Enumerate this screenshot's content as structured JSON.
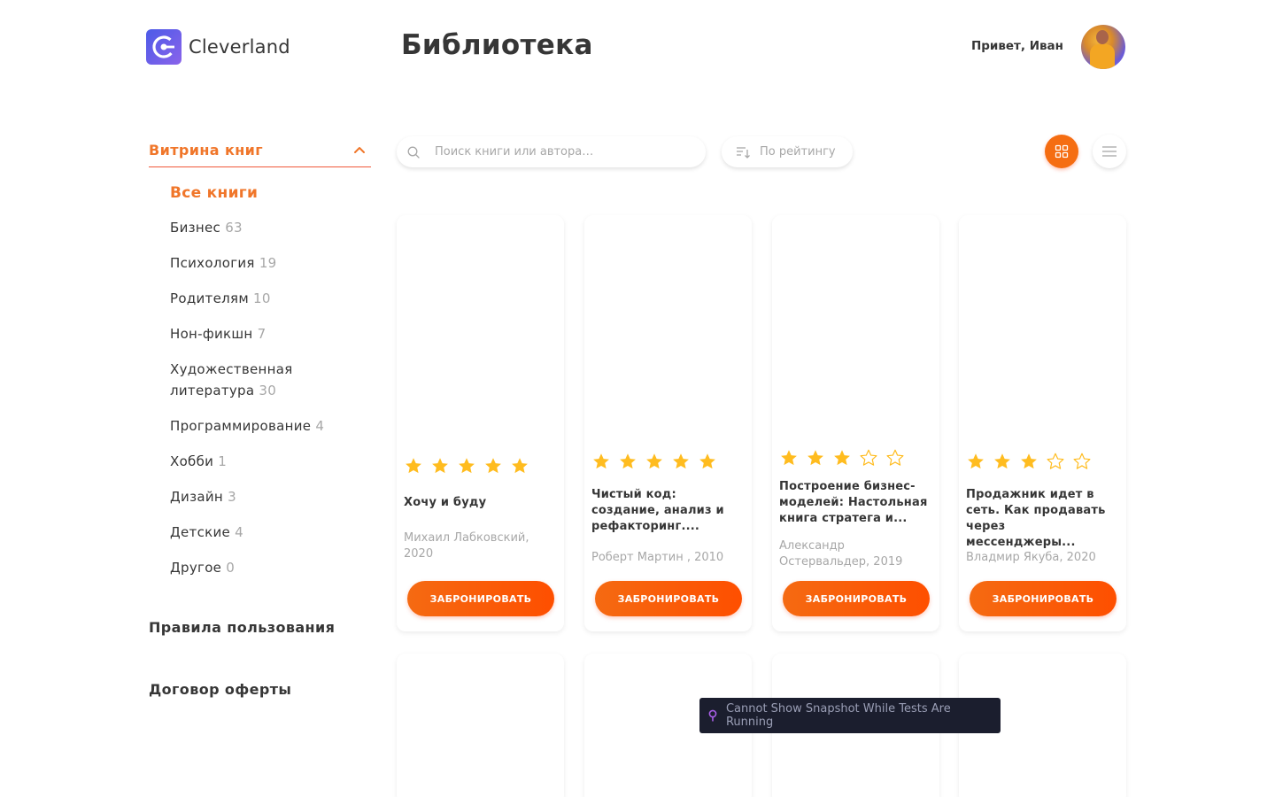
{
  "brand": {
    "name": "Cleverland",
    "accent": "#f56d12",
    "logo_color": "#6b5ee9"
  },
  "header": {
    "title": "Библиотека",
    "greeting": "Привет, Иван"
  },
  "sidebar": {
    "section_title": "Витрина книг",
    "categories": [
      {
        "label": "Все книги",
        "count": ""
      },
      {
        "label": "Бизнес",
        "count": "63"
      },
      {
        "label": "Психология",
        "count": "19"
      },
      {
        "label": "Родителям",
        "count": "10"
      },
      {
        "label": "Нон-фикшн",
        "count": "7"
      },
      {
        "label": "Художественная литература",
        "count": "30"
      },
      {
        "label": "Программирование",
        "count": "4"
      },
      {
        "label": "Хобби",
        "count": "1"
      },
      {
        "label": "Дизайн",
        "count": "3"
      },
      {
        "label": "Детские",
        "count": "4"
      },
      {
        "label": "Другое",
        "count": "0"
      }
    ],
    "rules_link": "Правила пользования",
    "offer_link": "Договор оферты"
  },
  "toolbar": {
    "search_placeholder": "Поиск книги или автора…",
    "sort_label": "По рейтингу",
    "active_view": "tiles"
  },
  "books": [
    {
      "title": "Хочу и буду",
      "author": "Михаил Лабковский, 2020",
      "rating": 5,
      "button": "ЗАБРОНИРОВАТЬ"
    },
    {
      "title": "Чистый код: создание, анализ и рефакторинг....",
      "author": "Роберт Мартин , 2010",
      "rating": 5,
      "button": "ЗАБРОНИРОВАТЬ"
    },
    {
      "title": "Построение бизнес-моделей: Настольная книга стратега и...",
      "author": "Александр Остервальдер, 2019",
      "rating": 3,
      "button": "ЗАБРОНИРОВАТЬ"
    },
    {
      "title": "Продажник идет в сеть. Как продавать через мессенджеры...",
      "author": "Владмир Якуба, 2020",
      "rating": 3,
      "button": "ЗАБРОНИРОВАТЬ"
    }
  ],
  "toast": {
    "text": "Cannot Show Snapshot While Tests Are Running",
    "icon": "pin-icon"
  }
}
